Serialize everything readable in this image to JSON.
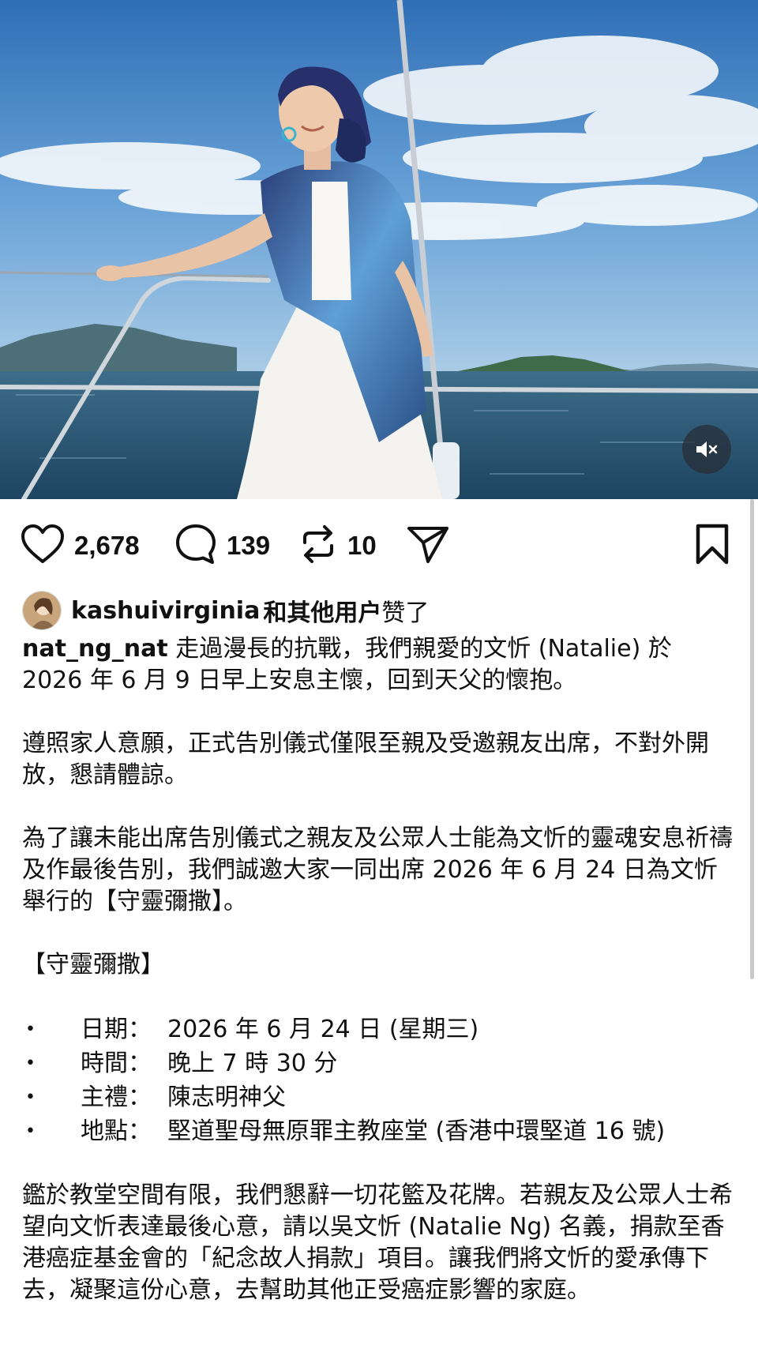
{
  "post": {
    "media": {
      "subject": "photo-woman-on-sailboat",
      "mute_icon": "speaker-muted-icon"
    },
    "actions": {
      "likes": "2,678",
      "comments": "139",
      "reposts": "10"
    },
    "liked_by": {
      "user": "kashuivirginia",
      "others": "和其他用户",
      "verb": "赞了"
    },
    "caption": {
      "author": "nat_ng_nat",
      "p1": " 走過漫長的抗戰，我們親愛的文忻 (Natalie) 於 2026 年 6 月 9 日早上安息主懷，回到天父的懷抱。",
      "p2": "遵照家人意願，正式告別儀式僅限至親及受邀親友出席，不對外開放，懇請體諒。",
      "p3": "為了讓未能出席告別儀式之親友及公眾人士能為文忻的靈魂安息祈禱及作最後告別，我們誠邀大家一同出席 2026 年 6 月 24 日為文忻舉行的【守靈彌撒】。",
      "section_title": "【守靈彌撒】",
      "details": [
        {
          "label": "日期：",
          "value": "2026 年 6 月 24 日 (星期三)"
        },
        {
          "label": "時間：",
          "value": "晚上 7 時 30 分"
        },
        {
          "label": "主禮：",
          "value": "陳志明神父"
        },
        {
          "label": "地點：",
          "value": "堅道聖母無原罪主教座堂 (香港中環堅道 16 號)"
        }
      ],
      "p4": "鑑於教堂空間有限，我們懇辭一切花籃及花牌。若親友及公眾人士希望向文忻表達最後心意，請以吳文忻 (Natalie Ng) 名義，捐款至香港癌症基金會的「紀念故人捐款」項目。讓我們將文忻的愛承傳下去，凝聚這份心意，去幫助其他正受癌症影響的家庭。"
    }
  },
  "icons": {
    "like": "heart-icon",
    "comment": "speech-bubble-icon",
    "repost": "repost-arrows-icon",
    "share": "paper-plane-icon",
    "save": "bookmark-icon"
  },
  "colors": {
    "text": "#111111",
    "sky": "#4a86c6",
    "sea": "#2e5a78"
  }
}
